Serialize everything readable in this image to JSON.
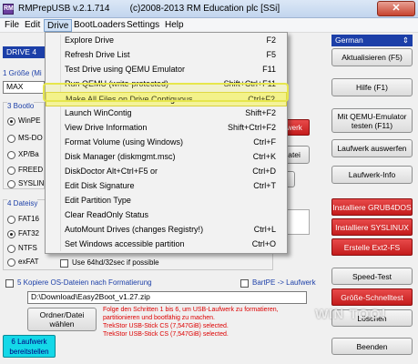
{
  "window": {
    "title": "RMPrepUSB v.2.1.714",
    "copyright": "(c)2008-2013 RM Education plc [SSi]",
    "close_label": "✕"
  },
  "menubar": [
    "File",
    "Edit",
    "Drive",
    "BootLoaders",
    "Settings",
    "Help"
  ],
  "drive_menu": [
    {
      "label": "Explore Drive",
      "shortcut": "F2"
    },
    {
      "label": "Refresh Drive List",
      "shortcut": "F5"
    },
    {
      "label": "Test Drive using QEMU Emulator",
      "shortcut": "F11"
    },
    {
      "label": "Run QEMU (write-protected)",
      "shortcut": "Shift+Ctrl+F11"
    },
    {
      "label": "Make All Files on Drive Contiguous",
      "shortcut": "Ctrl+F2"
    },
    {
      "label": "Launch WinContig",
      "shortcut": "Shift+F2"
    },
    {
      "label": "View Drive Information",
      "shortcut": "Shift+Ctrl+F2"
    },
    {
      "label": "Format Volume (using Windows)",
      "shortcut": "Ctrl+F"
    },
    {
      "label": "Disk Manager (diskmgmt.msc)",
      "shortcut": "Ctrl+K"
    },
    {
      "label": "DiskDoctor      Alt+Ctrl+F5 or",
      "shortcut": "Ctrl+D"
    },
    {
      "label": "Edit Disk Signature",
      "shortcut": "Ctrl+T"
    },
    {
      "label": "Edit Partition Type",
      "shortcut": ""
    },
    {
      "label": "Clear ReadOnly Status",
      "shortcut": ""
    },
    {
      "label": "AutoMount Drives (changes Registry!)",
      "shortcut": "Ctrl+L"
    },
    {
      "label": "Set Windows accessible partition",
      "shortcut": "Ctrl+O"
    }
  ],
  "left": {
    "drive_text": "DRIVE 4",
    "size_label": "1 Größe (Mi",
    "size_value": "MAX",
    "boot_label": "3 Bootlo",
    "boot_options": [
      "WinPE",
      "MS-DO",
      "XP/Ba",
      "FREED",
      "SYSLIN"
    ],
    "fs_label": "4 Dateisy",
    "fs_options": [
      "FAT16",
      "FAT32",
      "NTFS",
      "exFAT"
    ],
    "use64_label": "Use 64hd/32sec if possible",
    "partial_button_1": "ufwerk",
    "partial_button_2": "Datei",
    "partial_button_3": "fo",
    "partial_text": "ihr",
    "copy_label": "5 Kopiere OS-Dateien nach Formatierung",
    "bartpe_label": "BartPE -> Laufwerk",
    "path_value": "D:\\Download\\Easy2Boot_v1.27.zip",
    "choose_button": "Ordner/Datei wählen",
    "info_lines": [
      "Folge den Schritten 1 bis 6, um USB-Laufwerk zu formatieren,",
      "partitionieren und bootfähig zu machen.",
      "TrekStor USB-Stick CS (7,547GiB) selected.",
      "TrekStor USB-Stick CS (7,547GiB) selected."
    ],
    "prepare_button": "6 Laufwerk bereitstellen"
  },
  "right": {
    "language": "German",
    "refresh_button": "Aktualisieren (F5)",
    "help_button": "Hilfe (F1)",
    "qemu_button": "Mit QEMU-Emulator testen (F11)",
    "eject_button": "Laufwerk auswerfen",
    "info_button": "Laufwerk-Info",
    "grub_button": "Installiere GRUB4DOS",
    "syslinux_button": "Installiere SYSLINUX",
    "ext2_button": "Erstelle Ext2-FS",
    "speed_button": "Speed-Test",
    "quicktest_button": "Größe-Schnelltest",
    "clean_button": "Löschen",
    "exit_button": "Beenden"
  },
  "watermark": "WIN TOO!",
  "colors": {
    "highlight": "#f4f39a",
    "accent_red": "#cc1f1f",
    "cyan": "#14d8e8"
  }
}
